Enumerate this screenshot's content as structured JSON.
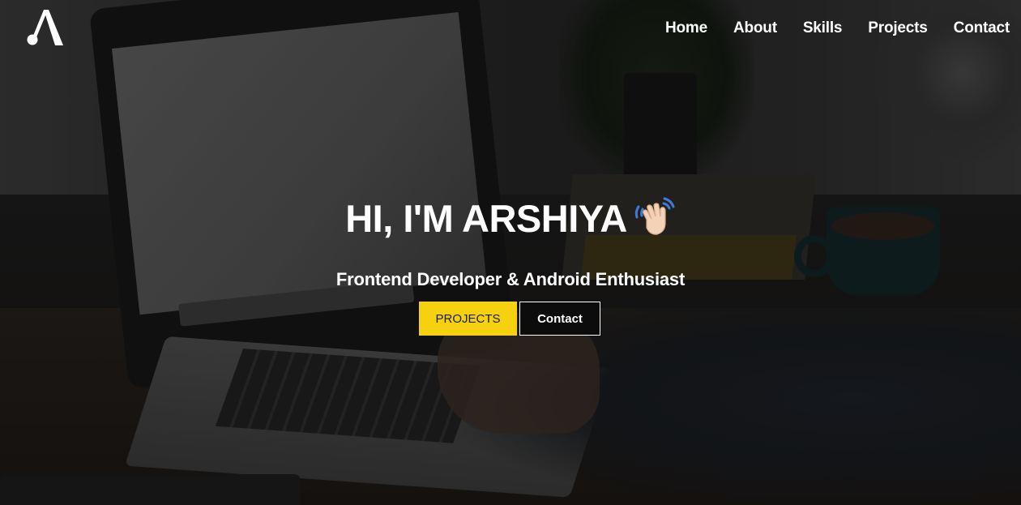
{
  "header": {
    "logo_icon": "triangle-letter-a-logo",
    "nav": [
      {
        "label": "Home"
      },
      {
        "label": "About"
      },
      {
        "label": "Skills"
      },
      {
        "label": "Projects"
      },
      {
        "label": "Contact"
      }
    ]
  },
  "hero": {
    "title": "HI, I'M ARSHIYA",
    "title_icon": "waving-hand-icon",
    "subtitle": "Frontend Developer & Android Enthusiast",
    "buttons": {
      "projects_label": "PROJECTS",
      "contact_label": "Contact"
    }
  },
  "colors": {
    "accent": "#f5d10f",
    "text": "#ffffff",
    "overlay": "#000000"
  }
}
